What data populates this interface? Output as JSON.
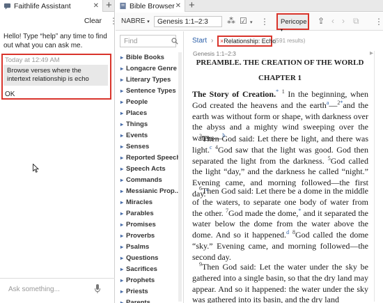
{
  "left_panel": {
    "tab_title": "Faithlife Assistant",
    "clear_label": "Clear",
    "greeting": "Hello! Type “help” any time to find out what you can ask me.",
    "timestamp": "Today at 12:49 AM",
    "user_message": "Browse verses where the intertext relationship is echo",
    "assistant_reply": "OK",
    "ask_placeholder": "Ask something..."
  },
  "right_panel": {
    "tab_title": "Bible Browser",
    "version": "NABRE",
    "reference": "Genesis 1:1–2:3",
    "pericope_label": "Pericope",
    "find_placeholder": "Find",
    "facets": [
      "Bible Books",
      "Longacre Genre",
      "Literary Types",
      "Sentence Types",
      "People",
      "Places",
      "Things",
      "Events",
      "Senses",
      "Reported Speech",
      "Speech Acts",
      "Commands",
      "Messianic Prop...",
      "Miracles",
      "Parables",
      "Promises",
      "Proverbs",
      "Psalms",
      "Questions",
      "Sacrifices",
      "Prophets",
      "Priests",
      "Parents"
    ],
    "breadcrumb_start": "Start",
    "breadcrumb_sep": "›",
    "filter_remove": "×",
    "filter_label": "Relationship: Echo",
    "result_count": "(591 results)",
    "verse_ref": "Genesis 1:1–2:3",
    "book_title": "PREAMBLE. THE CREATION OF THE WORLD",
    "chapter_title": "CHAPTER 1",
    "section_title": "The Story of Creation.",
    "p1": {
      "n1": "1",
      "t1": " In the beginning, when God created the heavens and the earth",
      "f1": "a",
      "t2": "—",
      "n2": "2",
      "t3": "and the earth was without form or shape, with darkness over the abyss and a mighty wind sweeping over the waters—",
      "f2": "b"
    },
    "p2": {
      "n3": "3",
      "t1": "Then God said: Let there be light, and there was light.",
      "f1": "c",
      "n4": "4",
      "t2": "God saw that the light was good. God then separated the light from the darkness.",
      "n5": "5",
      "t3": "God called the light “day,” and the darkness he called “night.” Evening came, and morning followed—the first day."
    },
    "p3": {
      "n6": "6",
      "t1": "Then God said: Let there be a dome in the middle of the waters, to separate one body of water from the other.",
      "n7": "7",
      "t2": "God made the dome,",
      "t3": " and it separated the water below the dome from the water above the dome. And so it happened.",
      "f1": "d",
      "n8": "8",
      "t4": "God called the dome “sky.” Evening came, and morning followed—the second day."
    },
    "p4": {
      "n9": "9",
      "t1": "Then God said: Let the water under the sky be gathered into a single basin, so that the dry land may appear. And so it happened: the water under the sky was gathered into its basin, and the dry land"
    }
  },
  "colors": {
    "highlight": "#d9342b",
    "link": "#2a5ea8"
  }
}
